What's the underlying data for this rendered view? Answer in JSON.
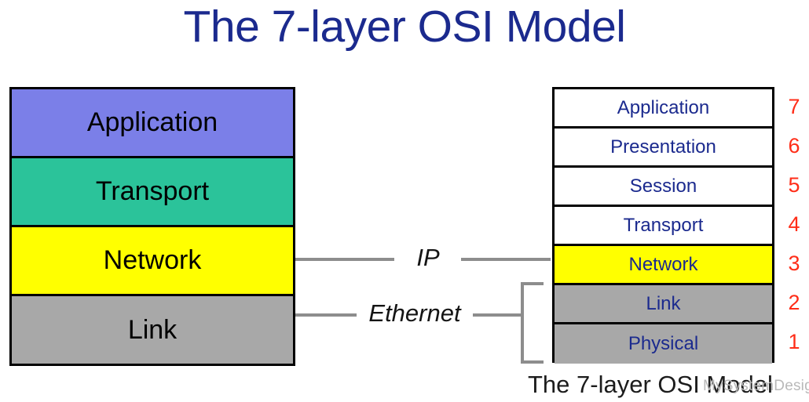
{
  "title": "The 7-layer OSI Model",
  "bottom_caption": "The 7-layer OSI Model",
  "watermark": "MySystemDesigningKit",
  "colors": {
    "title_blue": "#1b2a8e",
    "layer_text_blue": "#1b2a8e",
    "number_red": "#ff2d18",
    "application_purple": "#7b7fe8",
    "transport_teal": "#2bc39a",
    "network_yellow": "#ffff00",
    "link_gray": "#a8a8a8",
    "connector_gray": "#8d8d8d",
    "white": "#ffffff",
    "border_black": "#000000"
  },
  "left_stack": {
    "name": "tcp-ip-four-layer-stack",
    "layers": [
      {
        "label": "Application",
        "fill": "#7b7fe8"
      },
      {
        "label": "Transport",
        "fill": "#2bc39a"
      },
      {
        "label": "Network",
        "fill": "#ffff00"
      },
      {
        "label": "Link",
        "fill": "#a8a8a8"
      }
    ]
  },
  "right_stack": {
    "name": "osi-seven-layer-stack",
    "layers": [
      {
        "label": "Application",
        "number": "7",
        "fill": "#ffffff"
      },
      {
        "label": "Presentation",
        "number": "6",
        "fill": "#ffffff"
      },
      {
        "label": "Session",
        "number": "5",
        "fill": "#ffffff"
      },
      {
        "label": "Transport",
        "number": "4",
        "fill": "#ffffff"
      },
      {
        "label": "Network",
        "number": "3",
        "fill": "#ffff00"
      },
      {
        "label": "Link",
        "number": "2",
        "fill": "#a8a8a8"
      },
      {
        "label": "Physical",
        "number": "1",
        "fill": "#a8a8a8"
      }
    ]
  },
  "connectors": [
    {
      "label": "IP",
      "from": "Network",
      "to": "Network"
    },
    {
      "label": "Ethernet",
      "from": "Link",
      "to": "Link + Physical"
    }
  ]
}
